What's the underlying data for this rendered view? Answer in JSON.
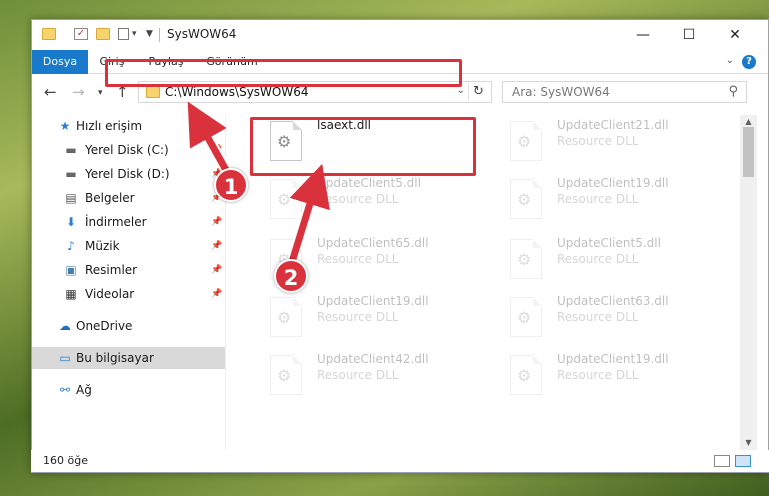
{
  "window": {
    "title": "SysWOW64",
    "controls": {
      "minimize": "—",
      "maximize": "☐",
      "close": "✕"
    }
  },
  "ribbon": {
    "tabs": [
      {
        "label": "Dosya",
        "active": true
      },
      {
        "label": "Giriş",
        "active": false
      },
      {
        "label": "Paylaş",
        "active": false
      },
      {
        "label": "Görünüm",
        "active": false
      }
    ],
    "help": "?"
  },
  "address_bar": {
    "path": "C:\\Windows\\SysWOW64",
    "search_placeholder": "Ara: SysWOW64"
  },
  "sidebar": {
    "items": [
      {
        "label": "Hızlı erişim",
        "icon": "★",
        "pinned": false,
        "selected": false
      },
      {
        "label": "Yerel Disk (C:)",
        "icon": "▬",
        "pinned": true,
        "selected": false
      },
      {
        "label": "Yerel Disk (D:)",
        "icon": "▬",
        "pinned": true,
        "selected": false
      },
      {
        "label": "Belgeler",
        "icon": "▤",
        "pinned": true,
        "selected": false
      },
      {
        "label": "İndirmeler",
        "icon": "⬇",
        "pinned": true,
        "selected": false
      },
      {
        "label": "Müzik",
        "icon": "♪",
        "pinned": true,
        "selected": false
      },
      {
        "label": "Resimler",
        "icon": "▣",
        "pinned": true,
        "selected": false
      },
      {
        "label": "Videolar",
        "icon": "▦",
        "pinned": true,
        "selected": false
      },
      {
        "label": "OneDrive",
        "icon": "☁",
        "pinned": false,
        "selected": false
      },
      {
        "label": "Bu bilgisayar",
        "icon": "▭",
        "pinned": false,
        "selected": true
      },
      {
        "label": "Ağ",
        "icon": "⚯",
        "pinned": false,
        "selected": false
      }
    ]
  },
  "files": [
    {
      "name": "lsaext.dll",
      "desc": "",
      "faded": false
    },
    {
      "name": "UpdateClient21.dll",
      "desc": "Resource DLL",
      "faded": true
    },
    {
      "name": "UpdateClient5.dll",
      "desc": "Resource DLL",
      "faded": true
    },
    {
      "name": "UpdateClient19.dll",
      "desc": "Resource DLL",
      "faded": true
    },
    {
      "name": "UpdateClient65.dll",
      "desc": "Resource DLL",
      "faded": true
    },
    {
      "name": "UpdateClient5.dll",
      "desc": "Resource DLL",
      "faded": true
    },
    {
      "name": "UpdateClient19.dll",
      "desc": "Resource DLL",
      "faded": true
    },
    {
      "name": "UpdateClient63.dll",
      "desc": "Resource DLL",
      "faded": true
    },
    {
      "name": "UpdateClient42.dll",
      "desc": "Resource DLL",
      "faded": true
    },
    {
      "name": "UpdateClient19.dll",
      "desc": "Resource DLL",
      "faded": true
    }
  ],
  "status": {
    "item_count": "160 öğe"
  },
  "annotations": {
    "step1": "1",
    "step2": "2",
    "color": "#d9323c"
  }
}
